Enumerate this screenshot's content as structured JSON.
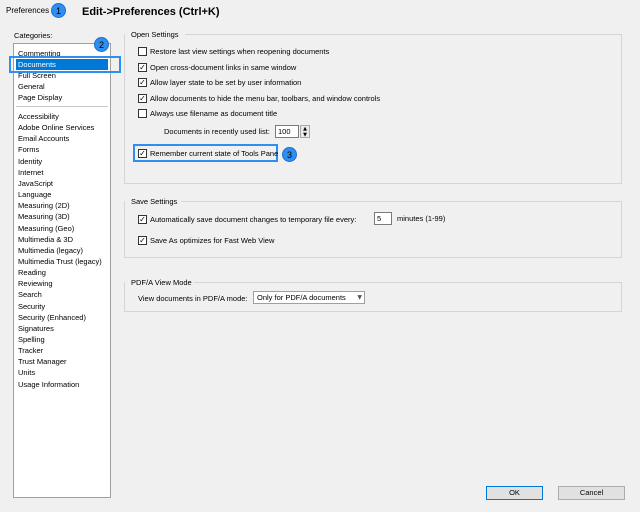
{
  "window": {
    "title": "Preferences",
    "shortcut_annotation": "Edit->Preferences (Ctrl+K)"
  },
  "callouts": {
    "c1": "1",
    "c2": "2",
    "c3": "3"
  },
  "categories": {
    "label": "Categories:",
    "group1": [
      "Commenting",
      "Documents",
      "Full Screen",
      "General",
      "Page Display"
    ],
    "selected": "Documents",
    "group2": [
      "Accessibility",
      "Adobe Online Services",
      "Email Accounts",
      "Forms",
      "Identity",
      "Internet",
      "JavaScript",
      "Language",
      "Measuring (2D)",
      "Measuring (3D)",
      "Measuring (Geo)",
      "Multimedia & 3D",
      "Multimedia (legacy)",
      "Multimedia Trust (legacy)",
      "Reading",
      "Reviewing",
      "Search",
      "Security",
      "Security (Enhanced)",
      "Signatures",
      "Spelling",
      "Tracker",
      "Trust Manager",
      "Units",
      "Usage Information"
    ]
  },
  "open_settings": {
    "title": "Open Settings",
    "options": [
      {
        "label": "Restore last view settings when reopening documents",
        "checked": false
      },
      {
        "label": "Open cross-document links in same window",
        "checked": true
      },
      {
        "label": "Allow layer state to be set by user information",
        "checked": true
      },
      {
        "label": "Allow documents to hide the menu bar, toolbars, and window controls",
        "checked": true
      },
      {
        "label": "Always use filename as document title",
        "checked": false
      }
    ],
    "recent_list_label": "Documents in recently used list:",
    "recent_list_value": "100",
    "tools_pane": {
      "label": "Remember current state of Tools Pane",
      "checked": true
    }
  },
  "save_settings": {
    "title": "Save Settings",
    "autosave": {
      "label": "Automatically save document changes to temporary file every:",
      "checked": true,
      "value": "5",
      "unit": "minutes (1-99)"
    },
    "fast_web": {
      "label": "Save As optimizes for Fast Web View",
      "checked": true
    }
  },
  "pdfa": {
    "title": "PDF/A View Mode",
    "label": "View documents in PDF/A mode:",
    "selected": "Only for PDF/A documents"
  },
  "buttons": {
    "ok": "OK",
    "cancel": "Cancel"
  },
  "colors": {
    "callout": "#2f8ff0",
    "selection": "#0078d7"
  }
}
